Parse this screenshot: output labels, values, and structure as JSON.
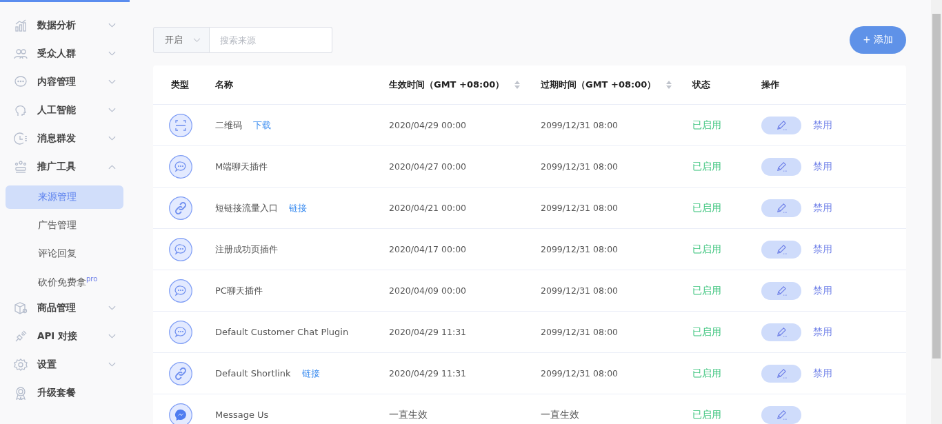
{
  "sidebar": {
    "items": [
      {
        "label": "数据分析",
        "expanded": false
      },
      {
        "label": "受众人群",
        "expanded": false
      },
      {
        "label": "内容管理",
        "expanded": false
      },
      {
        "label": "人工智能",
        "expanded": false
      },
      {
        "label": "消息群发",
        "expanded": false
      },
      {
        "label": "推广工具",
        "expanded": true,
        "children": [
          {
            "label": "来源管理",
            "selected": true
          },
          {
            "label": "广告管理",
            "selected": false
          },
          {
            "label": "评论回复",
            "selected": false
          },
          {
            "label": "砍价免费拿$^{pro}$",
            "selected": false
          }
        ]
      },
      {
        "label": "商品管理",
        "expanded": false
      },
      {
        "label": "API 对接",
        "expanded": false
      },
      {
        "label": "设置",
        "expanded": false
      },
      {
        "label": "升级套餐"
      }
    ]
  },
  "filter": {
    "status_value": "开启",
    "search_placeholder": "搜索来源"
  },
  "add_button": "+ 添加",
  "table": {
    "columns": [
      "类型",
      "名称",
      "生效时间（GMT +08:00）",
      "过期时间（GMT +08:00）",
      "状态",
      "操作"
    ],
    "rows": [
      {
        "kind": "qrcode",
        "name": "二维码",
        "download": "下载",
        "start": "2020/04/29 00:00",
        "end": "2099/12/31 08:00",
        "status": "已启用",
        "action": "禁用"
      },
      {
        "kind": "chat",
        "name": "M端聊天插件",
        "start": "2020/04/27 00:00",
        "end": "2099/12/31 08:00",
        "status": "已启用",
        "action": "禁用"
      },
      {
        "kind": "link",
        "name": "短链接流量入口",
        "link": "链接",
        "start": "2020/04/21 00:00",
        "end": "2099/12/31 08:00",
        "status": "已启用",
        "action": "禁用"
      },
      {
        "kind": "chat",
        "name": "注册成功页插件",
        "start": "2020/04/17 00:00",
        "end": "2099/12/31 08:00",
        "status": "已启用",
        "action": "禁用"
      },
      {
        "kind": "chat",
        "name": "PC聊天插件",
        "start": "2020/04/09 00:00",
        "end": "2099/12/31 08:00",
        "status": "已启用",
        "action": "禁用"
      },
      {
        "kind": "chat",
        "name": "Default Customer Chat Plugin",
        "start": "2020/04/29 11:31",
        "end": "2099/12/31 08:00",
        "status": "已启用",
        "action": "禁用"
      },
      {
        "kind": "link",
        "name": "Default Shortlink",
        "link": "链接",
        "start": "2020/04/29 11:31",
        "end": "2099/12/31 08:00",
        "status": "已启用",
        "action": "禁用"
      },
      {
        "kind": "messenger",
        "name": "Message Us",
        "start": "一直生效",
        "end": "一直生效",
        "status": "已启用"
      }
    ]
  }
}
